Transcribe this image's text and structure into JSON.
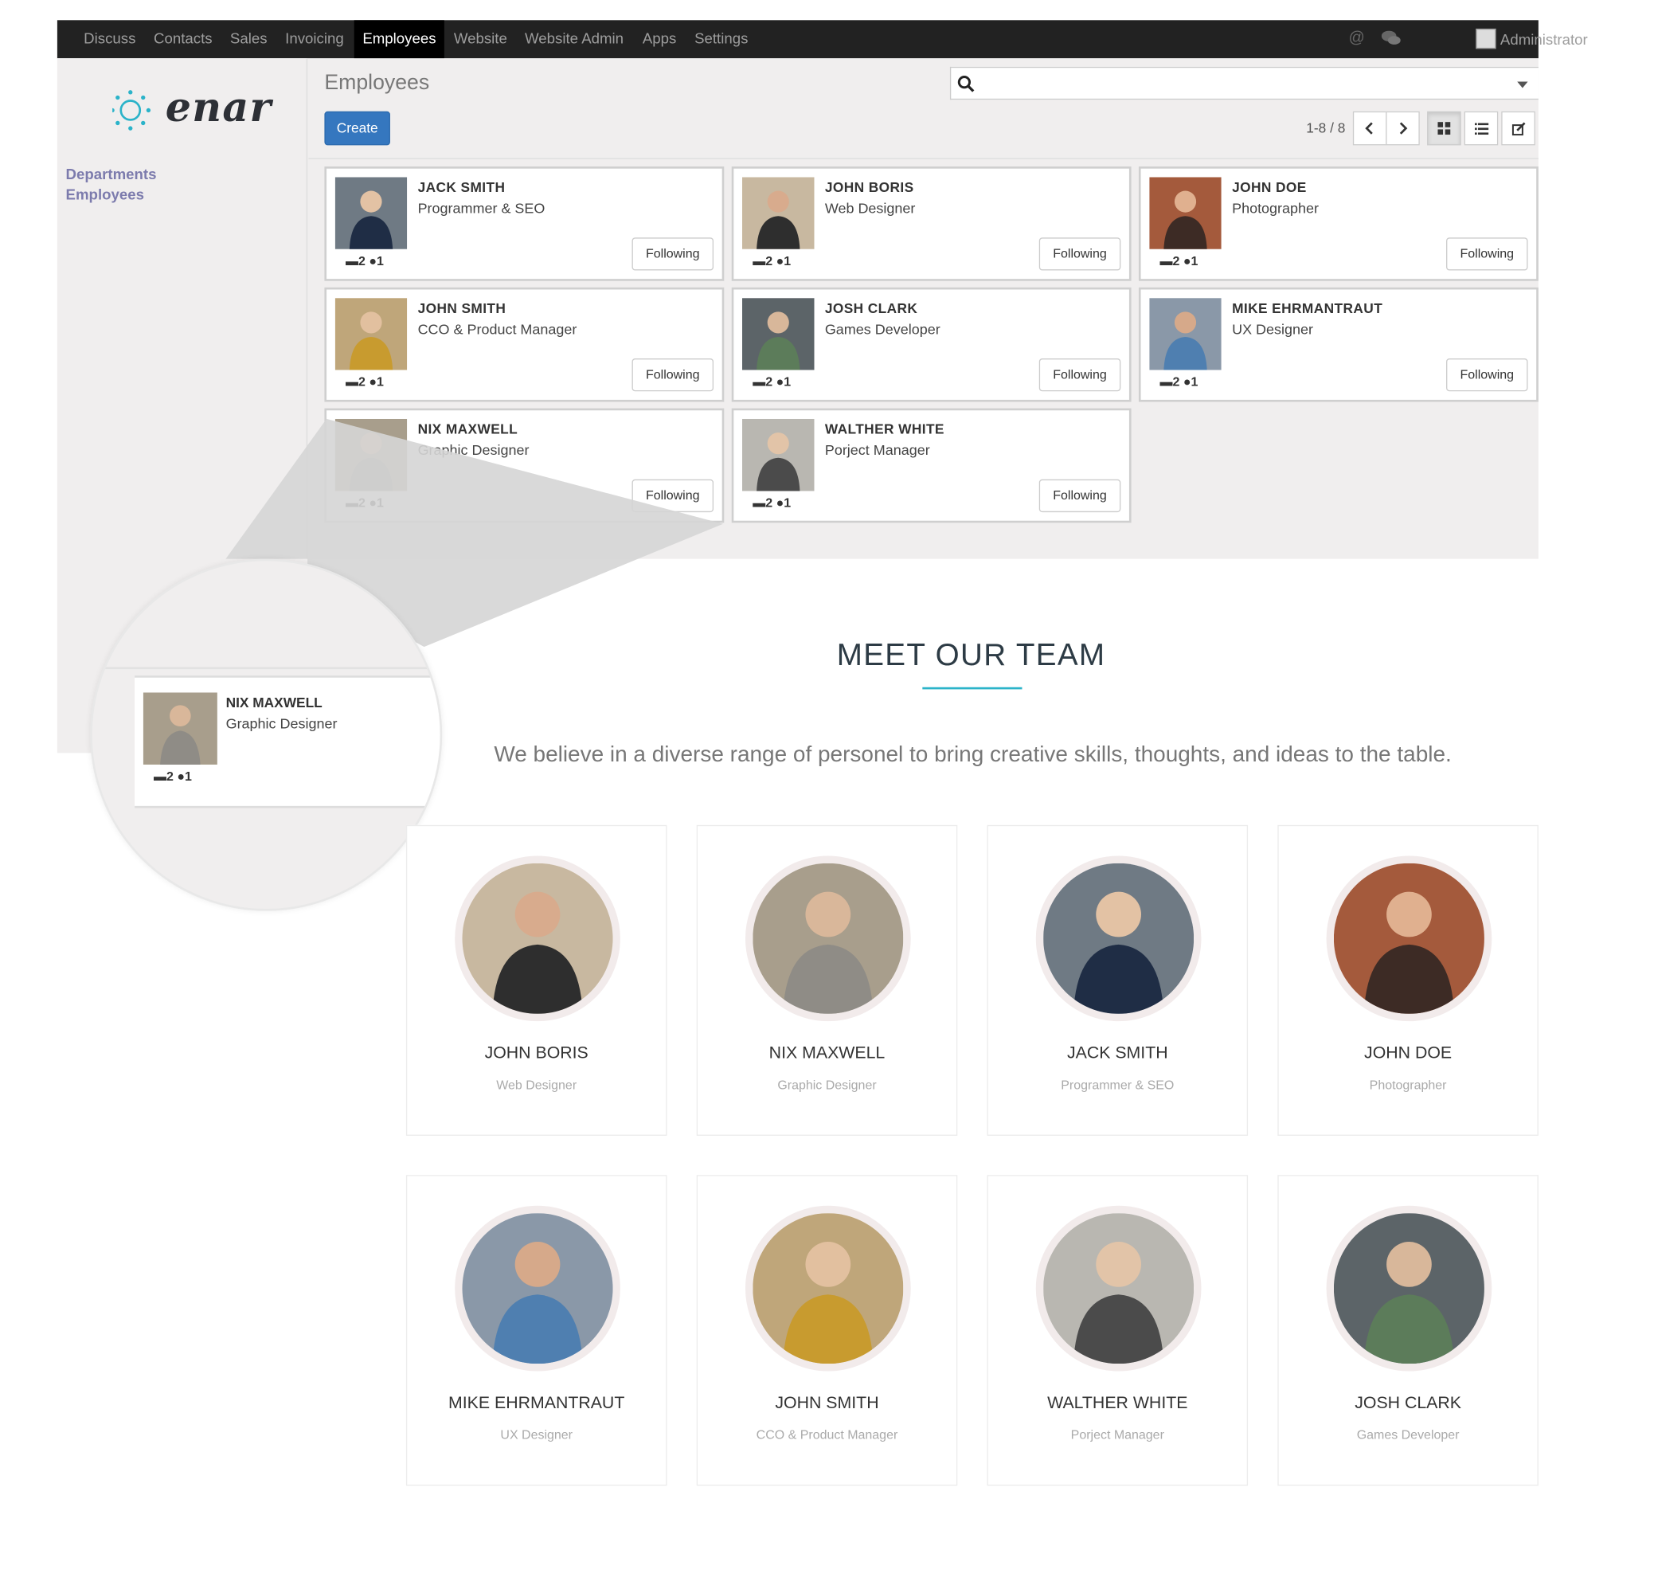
{
  "nav": {
    "menu": [
      "Discuss",
      "Contacts",
      "Sales",
      "Invoicing",
      "Employees",
      "Website",
      "Website Admin",
      "Apps",
      "Settings"
    ],
    "active": "Employees",
    "user": "Administrator"
  },
  "brand": {
    "logo_text": "enar",
    "accent": "#2bb3c9"
  },
  "sidebar": {
    "links": [
      "Departments",
      "Employees"
    ]
  },
  "control": {
    "title": "Employees",
    "create_label": "Create",
    "pager": "1-8 / 8",
    "search_value": ""
  },
  "employees": [
    {
      "name": "JACK SMITH",
      "title": "Programmer & SEO",
      "messages": "2",
      "followers": "1",
      "follow_label": "Following"
    },
    {
      "name": "JOHN BORIS",
      "title": "Web Designer",
      "messages": "2",
      "followers": "1",
      "follow_label": "Following"
    },
    {
      "name": "JOHN DOE",
      "title": "Photographer",
      "messages": "2",
      "followers": "1",
      "follow_label": "Following"
    },
    {
      "name": "JOHN SMITH",
      "title": "CCO & Product Manager",
      "messages": "2",
      "followers": "1",
      "follow_label": "Following"
    },
    {
      "name": "JOSH CLARK",
      "title": "Games Developer",
      "messages": "2",
      "followers": "1",
      "follow_label": "Following"
    },
    {
      "name": "MIKE EHRMANTRAUT",
      "title": "UX Designer",
      "messages": "2",
      "followers": "1",
      "follow_label": "Following"
    },
    {
      "name": "NIX MAXWELL",
      "title": "Graphic Designer",
      "messages": "2",
      "followers": "1",
      "follow_label": "Following"
    },
    {
      "name": "WALTHER WHITE",
      "title": "Porject Manager",
      "messages": "2",
      "followers": "1",
      "follow_label": "Following"
    }
  ],
  "zoom": {
    "name": "NIX MAXWELL",
    "title": "Graphic Designer",
    "messages": "2",
    "followers": "1"
  },
  "team": {
    "heading": "MEET OUR TEAM",
    "intro": "We believe in a diverse range of personel to bring creative skills, thoughts, and ideas to the table.",
    "members": [
      {
        "name": "JOHN BORIS",
        "role": "Web Designer"
      },
      {
        "name": "NIX MAXWELL",
        "role": "Graphic Designer"
      },
      {
        "name": "JACK SMITH",
        "role": "Programmer & SEO"
      },
      {
        "name": "JOHN DOE",
        "role": "Photographer"
      },
      {
        "name": "MIKE EHRMANTRAUT",
        "role": "UX Designer"
      },
      {
        "name": "JOHN SMITH",
        "role": "CCO & Product Manager"
      },
      {
        "name": "WALTHER WHITE",
        "role": "Porject Manager"
      },
      {
        "name": "JOSH CLARK",
        "role": "Games Developer"
      }
    ]
  }
}
